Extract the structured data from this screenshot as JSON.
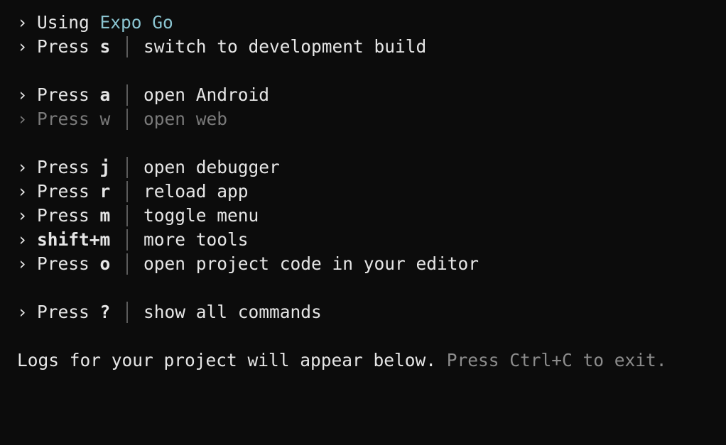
{
  "prompt_glyph": "›",
  "header": {
    "using_text": "Using",
    "app_name": "Expo Go"
  },
  "commands": [
    {
      "press": "Press",
      "key": "s",
      "description": "switch to development build"
    },
    {
      "press": "Press",
      "key": "a",
      "description": "open Android"
    },
    {
      "press": "Press",
      "key": "w",
      "description": "open web"
    },
    {
      "press": "Press",
      "key": "j",
      "description": "open debugger"
    },
    {
      "press": "Press",
      "key": "r",
      "description": "reload app"
    },
    {
      "press": "Press",
      "key": "m",
      "description": "toggle menu"
    },
    {
      "press": "",
      "key": "shift+m",
      "description": "more tools"
    },
    {
      "press": "Press",
      "key": "o",
      "description": "open project code in your editor"
    },
    {
      "press": "Press",
      "key": "?",
      "description": "show all commands"
    }
  ],
  "footer": {
    "logs_text": "Logs for your project will appear below.",
    "exit_hint": "Press Ctrl+C to exit."
  },
  "colors": {
    "background": "#0c0c0c",
    "text": "#e6e6e6",
    "accent": "#8ac4d0",
    "dimmed": "#7a7a7a",
    "divider": "#5b5b5b"
  }
}
